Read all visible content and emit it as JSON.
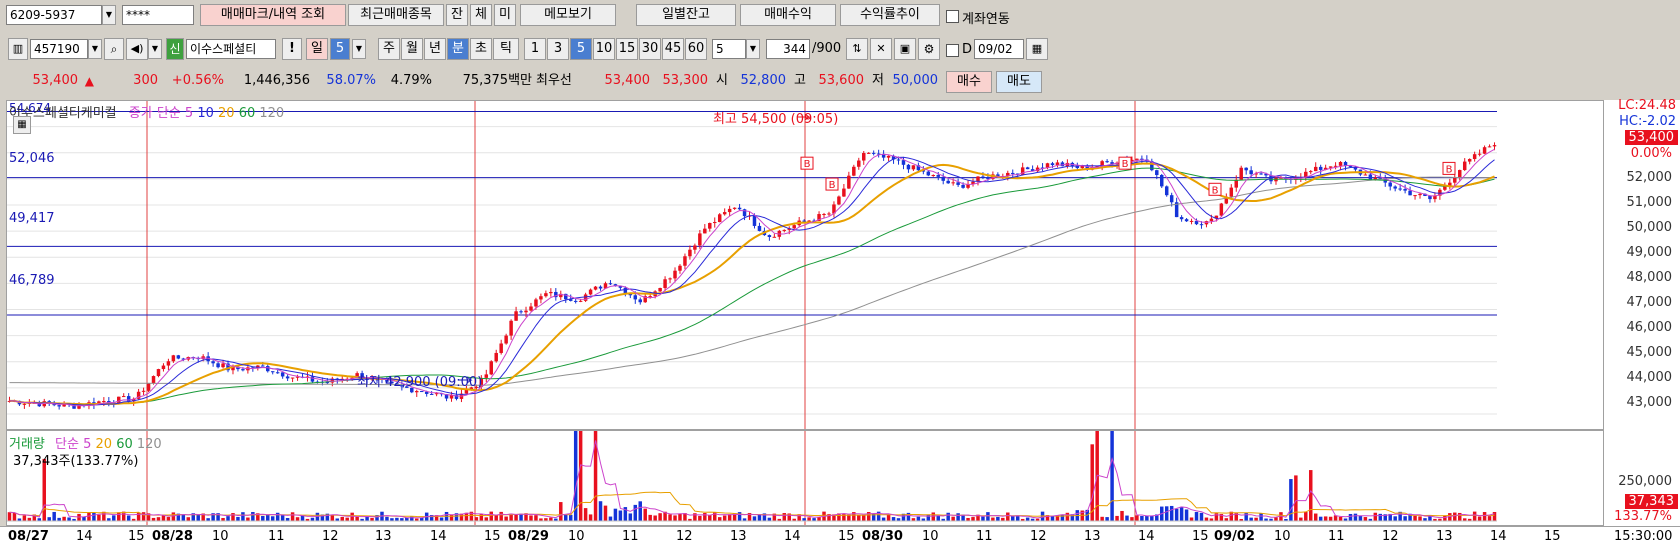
{
  "toolbar1": {
    "account": "6209-5937",
    "password": "****",
    "btn_trade_mark": "매매마크/내역 조회",
    "btn_recent_items": "최근매매종목",
    "btn_jan": "잔",
    "btn_che": "체",
    "btn_mi": "미",
    "btn_memo": "메모보기",
    "btn_daily_balance": "일별잔고",
    "btn_trade_profit": "매매수익",
    "btn_return_trend": "수익률추이",
    "account_link_label": "계좌연동"
  },
  "toolbar2": {
    "code": "457190",
    "credit_badge": "신",
    "stock_name": "이수스페셜티",
    "alert": "!",
    "period_day": "일",
    "period_value": "5",
    "periods": [
      "주",
      "월",
      "년",
      "분",
      "초",
      "틱"
    ],
    "minutes": [
      "1",
      "3",
      "5",
      "10",
      "15",
      "30",
      "45",
      "60"
    ],
    "count": "5",
    "bars_shown": "344",
    "bars_total": "/900",
    "d_label": "D",
    "date": "09/02"
  },
  "quote": {
    "price": "53,400",
    "arrow": "▲",
    "change": "300",
    "change_pct": "+0.56%",
    "volume": "1,446,356",
    "ratio1": "58.07%",
    "ratio2": "4.79%",
    "amount": "75,375백만",
    "best_label": "최우선",
    "ask": "53,400",
    "bid": "53,300",
    "open_label": "시",
    "open": "52,800",
    "high_label": "고",
    "high": "53,600",
    "low_label": "저",
    "low": "50,000",
    "buy": "매수",
    "sell": "매도"
  },
  "price_chart": {
    "top_value": "54,674",
    "legend_name": "이수스페셜티케미컬",
    "legend_ma_label": "종가 단순",
    "legend_ma_values": [
      "5",
      "10",
      "20",
      "60",
      "120"
    ],
    "hlines": [
      "52,046",
      "49,417",
      "46,789"
    ],
    "high_note": "최고 54,500 (09:05)",
    "low_note": "최저 42,900 (09:00)",
    "lc": "LC:24.48",
    "hc": "HC:-2.02",
    "current": "53,400",
    "change_pct": "0.00%",
    "y_ticks": [
      "52,000",
      "51,000",
      "50,000",
      "49,000",
      "48,000",
      "47,000",
      "46,000",
      "45,000",
      "44,000",
      "43,000"
    ]
  },
  "volume_chart": {
    "legend_label": "거래량",
    "legend_ma_label": "단순",
    "legend_ma_values": [
      "5",
      "20",
      "60",
      "120"
    ],
    "volume_text": "37,343주(133.77%)",
    "y_tick": "250,000",
    "current": "37,343",
    "pct": "133.77%"
  },
  "xaxis": {
    "labels": [
      "08/27",
      "14",
      "15",
      "08/28",
      "10",
      "11",
      "12",
      "13",
      "14",
      "15",
      "08/29",
      "10",
      "11",
      "12",
      "13",
      "14",
      "15",
      "08/30",
      "10",
      "11",
      "12",
      "13",
      "14",
      "15",
      "09/02",
      "10",
      "11",
      "12",
      "13",
      "14",
      "15"
    ],
    "time": "15:30:00"
  },
  "colors": {
    "up": "#e8101e",
    "down": "#1433d8",
    "ma5": "#cc44cc",
    "ma10": "#2a2ad8",
    "ma20": "#e8a000",
    "ma60": "#1a9a3a",
    "ma120": "#909090",
    "hline": "#1a1ab4",
    "vline": "#e04040"
  },
  "chart_data": {
    "type": "candlestick",
    "title": "이수스페셜티케미컬",
    "x_sessions": [
      "08/27",
      "08/28",
      "08/29",
      "08/30",
      "09/02"
    ],
    "y_range": [
      42500,
      54674
    ],
    "key_levels": [
      52046,
      49417,
      46789
    ],
    "high": {
      "value": 54500,
      "time": "08/30 09:05"
    },
    "low": {
      "value": 42900,
      "time": "08/29 09:00"
    },
    "close_path": [
      43500,
      43400,
      43300,
      43500,
      43600,
      45100,
      45200,
      44700,
      44800,
      44400,
      44200,
      44500,
      44100,
      43900,
      43600,
      44300,
      46800,
      47600,
      47400,
      48100,
      47300,
      48400,
      50100,
      51000,
      49800,
      50300,
      50700,
      53000,
      52700,
      52200,
      51700,
      52100,
      52300,
      52600,
      52400,
      52700,
      52800,
      50500,
      50300,
      52400,
      51900,
      52200,
      52600,
      52100,
      51600,
      51200,
      52500,
      53400
    ],
    "volume_peak": 250000,
    "last_volume": 37343
  }
}
